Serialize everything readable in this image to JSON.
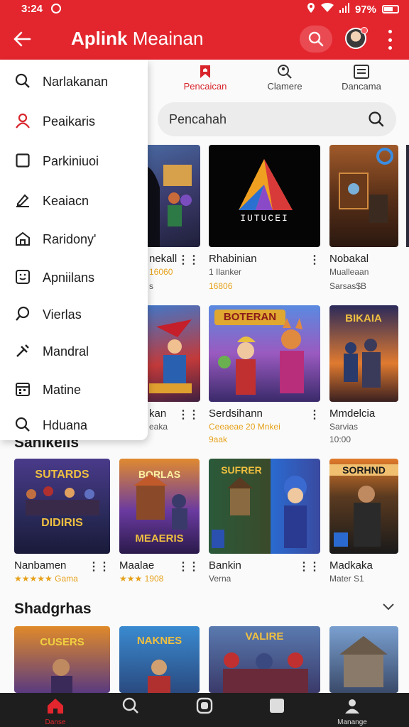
{
  "status_bar": {
    "time": "3:24",
    "battery": "97%"
  },
  "app_bar": {
    "title_bold": "Aplink",
    "title_rest": "Meainan"
  },
  "tabs": [
    {
      "label": "Pencaican",
      "icon": "bookmark-house-icon",
      "active": true
    },
    {
      "label": "Clamere",
      "icon": "people-search-icon",
      "active": false
    },
    {
      "label": "Dancama",
      "icon": "list-box-icon",
      "active": false
    }
  ],
  "search": {
    "placeholder": "Pencahah"
  },
  "drawer": {
    "items": [
      {
        "label": "Narlakanan",
        "icon": "search-icon"
      },
      {
        "label": "Peaikaris",
        "icon": "person-icon"
      },
      {
        "label": "Parkiniuoi",
        "icon": "square-icon"
      },
      {
        "label": "Keaiacn",
        "icon": "pen-box-icon"
      },
      {
        "label": "Raridony'",
        "icon": "house-icon"
      },
      {
        "label": "Apniilans",
        "icon": "smile-box-icon"
      },
      {
        "label": "Vierlas",
        "icon": "magnifier-icon"
      },
      {
        "label": "Mandral",
        "icon": "tools-icon"
      },
      {
        "label": "Matine",
        "icon": "calendar-icon"
      },
      {
        "label": "Hduana",
        "icon": "search-icon"
      }
    ]
  },
  "row1": [
    {
      "title": "nekall",
      "sub": "16060",
      "sub2": "s"
    },
    {
      "title": "Rhabinian",
      "sub": "1 Ilanker",
      "sub2": "16806",
      "art_text": "IUTUCEI"
    },
    {
      "title": "Nobakal",
      "sub": "Mualleaan",
      "sub2": "Sarsas$B"
    }
  ],
  "row2": [
    {
      "title": "kan",
      "sub": "eaka"
    },
    {
      "title": "Serdsihann",
      "sub": "Ceeaeae 20 Mnkei",
      "sub2": "9aak",
      "art_text": "BOTERAN"
    },
    {
      "title": "Mmdelcia",
      "sub": "Sarvias",
      "sub2": "10:00",
      "art_text": "BIKAIA"
    }
  ],
  "section1": {
    "title": "Sanikelis"
  },
  "row3": [
    {
      "title": "Nanbamen",
      "sub": "★★★★★ Gama",
      "art_text": "SUTARDS",
      "art_text2": "DIDIRIS"
    },
    {
      "title": "Maalae",
      "sub": "★★★ 1908",
      "art_text": "BORLAS",
      "art_text2": "MEAERIS"
    },
    {
      "title": "Bankin",
      "sub": "Verna",
      "art_text": "SUFRER"
    },
    {
      "title": "Madkaka",
      "sub": "Mater S1",
      "art_text": "SORHND"
    }
  ],
  "section2": {
    "title": "Shadgrhas"
  },
  "row4": [
    {
      "art_text": "CUSERS"
    },
    {
      "art_text": "NAKNES"
    },
    {
      "art_text": "VALIRE"
    },
    {
      "art_text": ""
    }
  ],
  "bottom_nav": [
    {
      "label": "Danse",
      "icon": "home-icon",
      "active": true
    },
    {
      "label": "",
      "icon": "search-icon",
      "active": false
    },
    {
      "label": "",
      "icon": "square-rounded-icon",
      "active": false
    },
    {
      "label": "",
      "icon": "square-icon",
      "active": false
    },
    {
      "label": "Manange",
      "icon": "profile-icon",
      "active": false
    }
  ],
  "colors": {
    "brand_red": "#e3262e",
    "rating_gold": "#e6a21c",
    "nav_dark": "#1e1e1e"
  }
}
